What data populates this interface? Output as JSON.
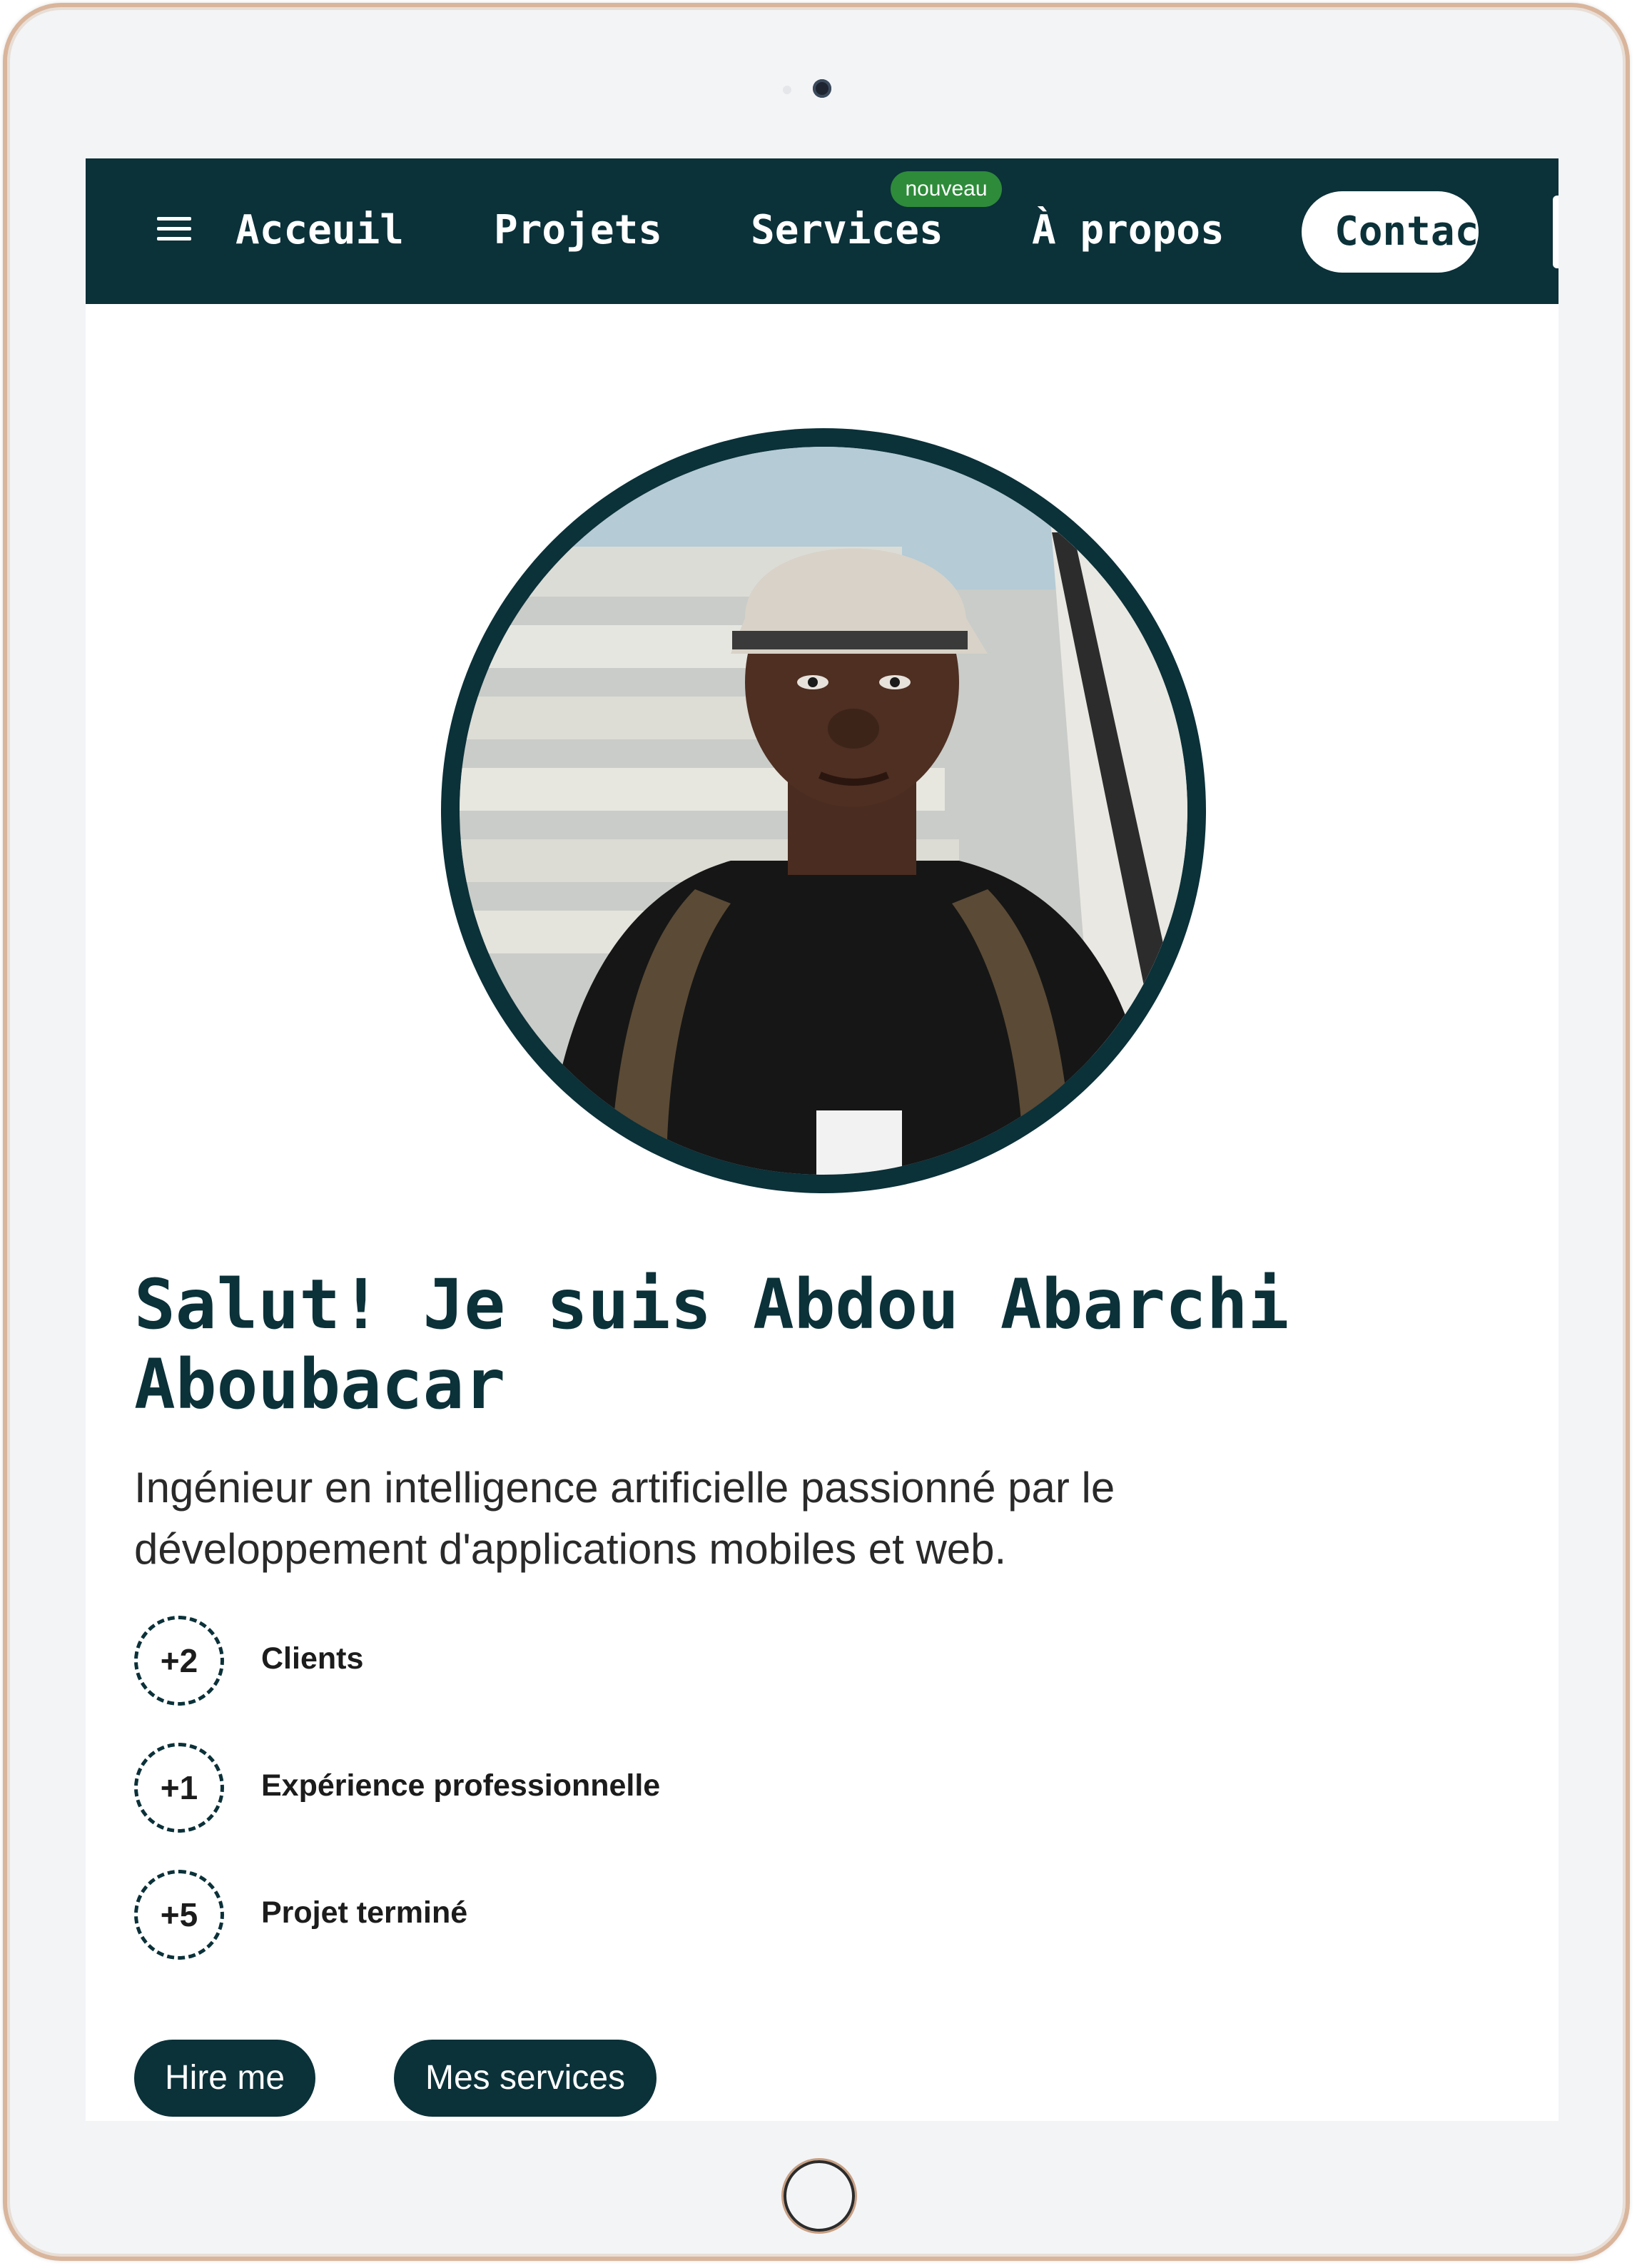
{
  "nav": {
    "items": [
      {
        "label": "Acceuil"
      },
      {
        "label": "Projets"
      },
      {
        "label": "Services",
        "badge": "nouveau"
      },
      {
        "label": "À propos"
      },
      {
        "label": "Contact"
      }
    ],
    "menu_icon": "hamburger-menu-icon",
    "colors": {
      "background": "#0b3139",
      "badge": "#2e8b3a"
    }
  },
  "hero": {
    "avatar_description": "Profile photo of a man wearing a white cap and a black t-shirt with backpack straps",
    "title": "Salut! Je suis Abdou Abarchi Aboubacar",
    "description": "Ingénieur en intelligence artificielle passionné par le développement d'applications mobiles et web."
  },
  "stats": [
    {
      "value": "+2",
      "label": "Clients"
    },
    {
      "value": "+1",
      "label": "Expérience professionnelle"
    },
    {
      "value": "+5",
      "label": "Projet terminé"
    }
  ],
  "actions": {
    "hire_label": "Hire me",
    "services_label": "Mes services"
  },
  "theme": {
    "primary": "#0b3139",
    "text": "#2a2a2a"
  }
}
